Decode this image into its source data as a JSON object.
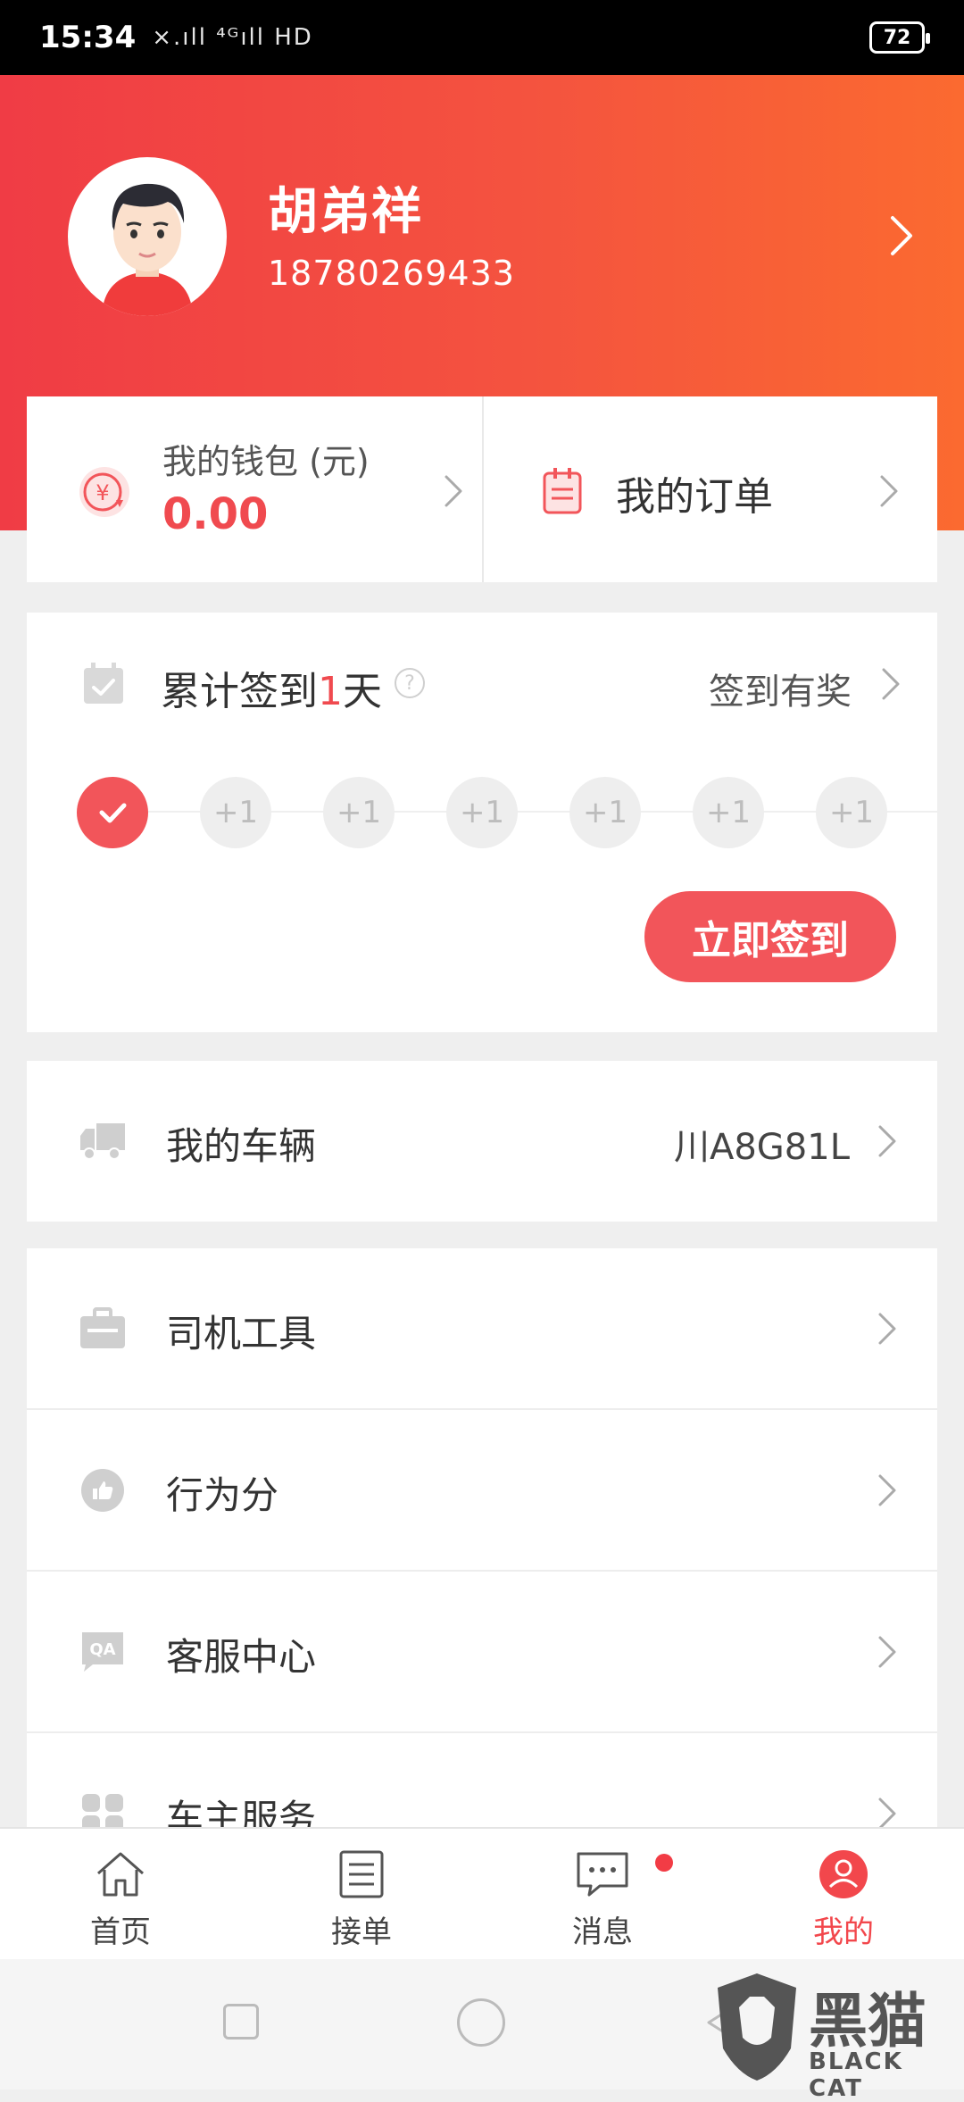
{
  "status_bar": {
    "time": "15:34",
    "signal": "×.ıll ⁴ᴳıll HD",
    "battery": "72"
  },
  "profile": {
    "name": "胡弟祥",
    "phone": "18780269433"
  },
  "wallet": {
    "label": "我的钱包 (元)",
    "value": "0.00"
  },
  "orders": {
    "label": "我的订单"
  },
  "signin": {
    "title_prefix": "累计签到",
    "days": "1",
    "title_suffix": "天",
    "reward_link": "签到有奖",
    "day_bonus": [
      "+1",
      "+1",
      "+1",
      "+1",
      "+1",
      "+1"
    ],
    "button": "立即签到"
  },
  "vehicle": {
    "label": "我的车辆",
    "plate": "川A8G81L"
  },
  "menu": [
    {
      "label": "司机工具"
    },
    {
      "label": "行为分"
    },
    {
      "label": "客服中心"
    },
    {
      "label": "车主服务"
    }
  ],
  "tabs": [
    {
      "label": "首页",
      "icon": "home-icon"
    },
    {
      "label": "接单",
      "icon": "list-icon"
    },
    {
      "label": "消息",
      "icon": "message-icon"
    },
    {
      "label": "我的",
      "icon": "user-icon"
    }
  ],
  "watermark": {
    "main": "黑猫",
    "sub": "BLACK CAT"
  },
  "colors": {
    "accent": "#f2555a",
    "header_start": "#f03c45",
    "header_end": "#fb6a30"
  }
}
